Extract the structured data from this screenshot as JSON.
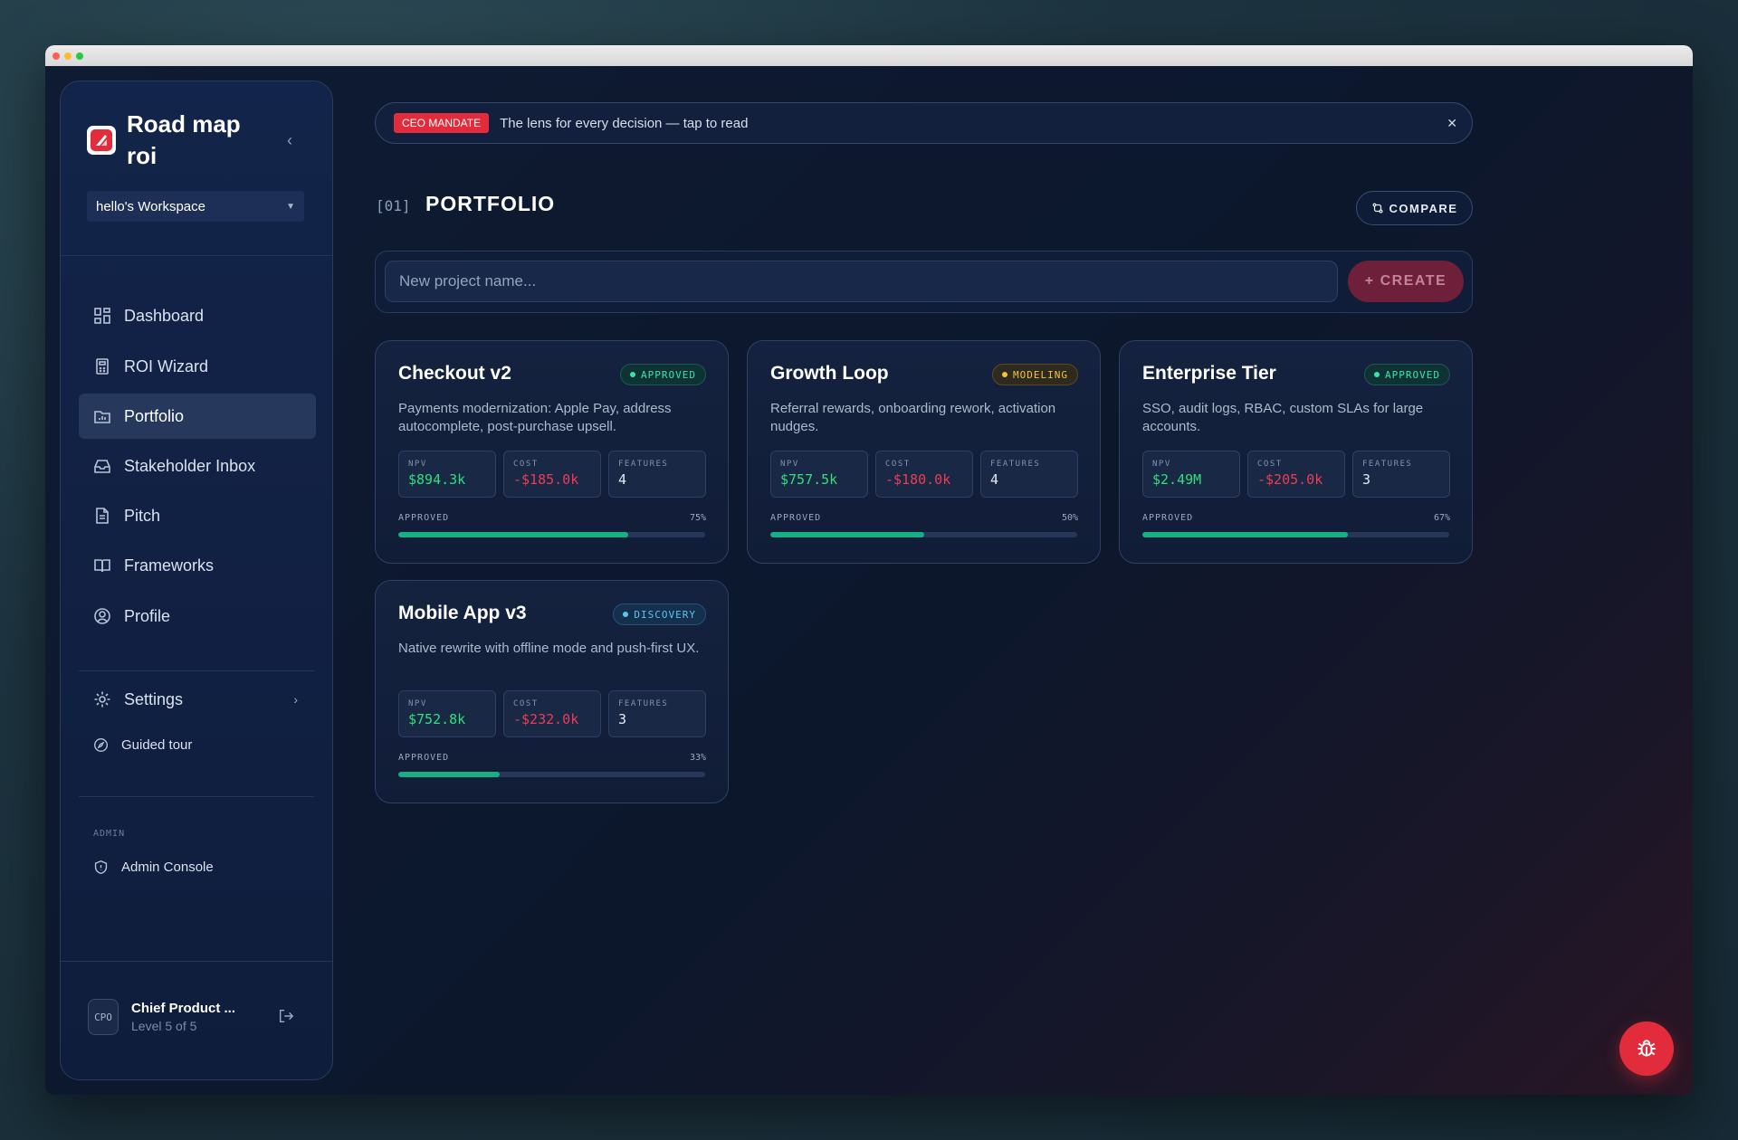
{
  "brand": {
    "title": "Road map roi"
  },
  "workspace": {
    "name": "hello's Workspace"
  },
  "nav": {
    "items": [
      {
        "label": "Dashboard",
        "icon": "grid-icon"
      },
      {
        "label": "ROI Wizard",
        "icon": "calculator-icon"
      },
      {
        "label": "Portfolio",
        "icon": "folder-chart-icon",
        "active": true
      },
      {
        "label": "Stakeholder Inbox",
        "icon": "inbox-icon"
      },
      {
        "label": "Pitch",
        "icon": "document-icon"
      },
      {
        "label": "Frameworks",
        "icon": "book-icon"
      },
      {
        "label": "Profile",
        "icon": "user-circle-icon"
      }
    ],
    "settings": "Settings",
    "guided_tour": "Guided tour",
    "admin_section": "ADMIN",
    "admin_console": "Admin Console"
  },
  "user": {
    "avatar": "CPO",
    "name": "Chief Product ...",
    "level": "Level 5 of 5"
  },
  "banner": {
    "badge": "CEO MANDATE",
    "text": "The lens for every decision — tap to read"
  },
  "section": {
    "index": "[01]",
    "title": "PORTFOLIO",
    "compare": "COMPARE"
  },
  "create": {
    "placeholder": "New project name...",
    "button": "+ CREATE"
  },
  "projects": [
    {
      "title": "Checkout v2",
      "status": "APPROVED",
      "status_type": "approved",
      "desc": "Payments modernization: Apple Pay, address autocomplete, post-purchase upsell.",
      "npv": "$894.3k",
      "cost": "-$185.0k",
      "features": "4",
      "progress_label": "APPROVED",
      "progress_pct": "75%",
      "progress": 0.75
    },
    {
      "title": "Growth Loop",
      "status": "MODELING",
      "status_type": "modeling",
      "desc": "Referral rewards, onboarding rework, activation nudges.",
      "npv": "$757.5k",
      "cost": "-$180.0k",
      "features": "4",
      "progress_label": "APPROVED",
      "progress_pct": "50%",
      "progress": 0.5
    },
    {
      "title": "Enterprise Tier",
      "status": "APPROVED",
      "status_type": "approved",
      "desc": "SSO, audit logs, RBAC, custom SLAs for large accounts.",
      "npv": "$2.49M",
      "cost": "-$205.0k",
      "features": "3",
      "progress_label": "APPROVED",
      "progress_pct": "67%",
      "progress": 0.67
    },
    {
      "title": "Mobile App v3",
      "status": "DISCOVERY",
      "status_type": "discovery",
      "desc": "Native rewrite with offline mode and push-first UX.",
      "npv": "$752.8k",
      "cost": "-$232.0k",
      "features": "3",
      "progress_label": "APPROVED",
      "progress_pct": "33%",
      "progress": 0.33
    }
  ],
  "metric_labels": {
    "npv": "NPV",
    "cost": "COST",
    "features": "FEATURES"
  },
  "colors": {
    "accent": "#e22c3b",
    "approved": "#3ce2a8",
    "modeling": "#f3c33c",
    "discovery": "#5cc3f3",
    "progress": "#17b086"
  }
}
